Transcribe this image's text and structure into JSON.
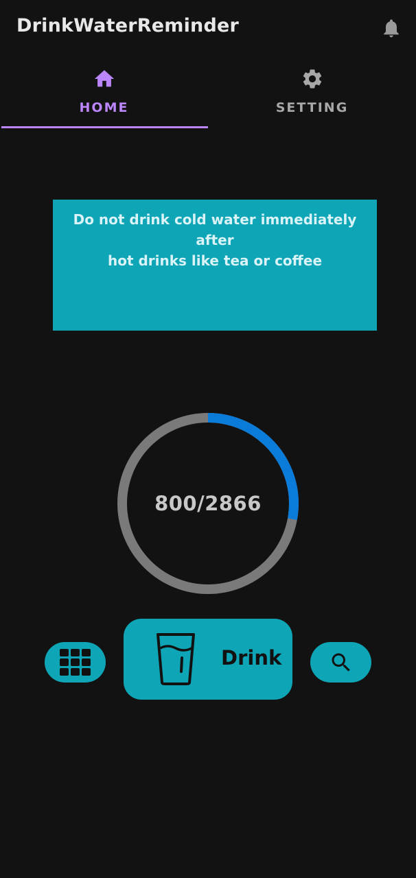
{
  "app": {
    "title": "DrinkWaterReminder",
    "icons": {
      "notification": "bell-icon"
    }
  },
  "tabs": [
    {
      "label": "HOME",
      "icon": "home-icon",
      "selected": true
    },
    {
      "label": "SETTING",
      "icon": "gear-icon",
      "selected": false
    }
  ],
  "tip": {
    "text": "Do not drink cold water immediately after\nhot drinks like tea or coffee"
  },
  "progress": {
    "consumed": 800,
    "goal": 2866,
    "label": "800/2866"
  },
  "actions": {
    "drink_label": "Drink",
    "grid_icon": "grid-icon",
    "search_icon": "search-icon",
    "drink_icon": "water-glass-icon"
  },
  "colors": {
    "background": "#121212",
    "accent": "#bb86fc",
    "card": "#0ea5b7",
    "progress_fill": "#0a7bd8",
    "progress_track": "#7a7a7a"
  }
}
